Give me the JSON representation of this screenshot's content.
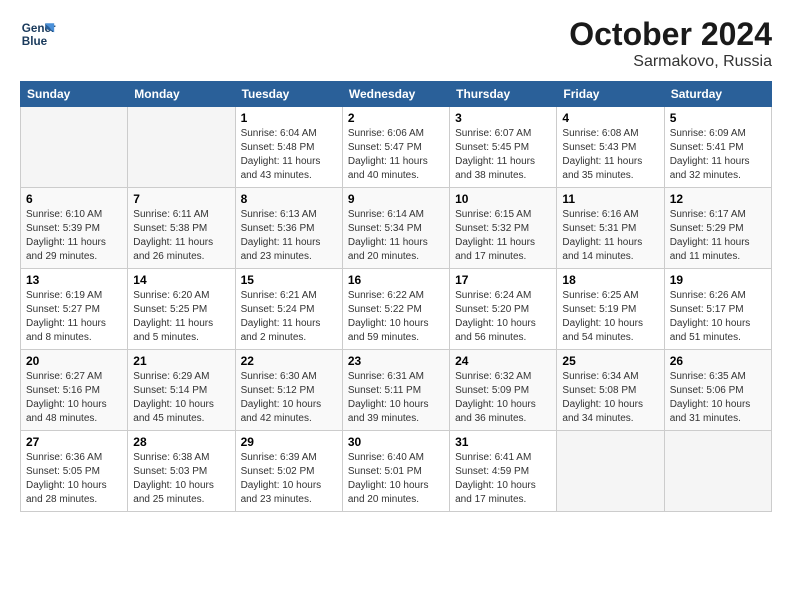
{
  "header": {
    "logo_line1": "General",
    "logo_line2": "Blue",
    "month_title": "October 2024",
    "location": "Sarmakovo, Russia"
  },
  "weekdays": [
    "Sunday",
    "Monday",
    "Tuesday",
    "Wednesday",
    "Thursday",
    "Friday",
    "Saturday"
  ],
  "weeks": [
    [
      {
        "day": "",
        "info": ""
      },
      {
        "day": "",
        "info": ""
      },
      {
        "day": "1",
        "info": "Sunrise: 6:04 AM\nSunset: 5:48 PM\nDaylight: 11 hours\nand 43 minutes."
      },
      {
        "day": "2",
        "info": "Sunrise: 6:06 AM\nSunset: 5:47 PM\nDaylight: 11 hours\nand 40 minutes."
      },
      {
        "day": "3",
        "info": "Sunrise: 6:07 AM\nSunset: 5:45 PM\nDaylight: 11 hours\nand 38 minutes."
      },
      {
        "day": "4",
        "info": "Sunrise: 6:08 AM\nSunset: 5:43 PM\nDaylight: 11 hours\nand 35 minutes."
      },
      {
        "day": "5",
        "info": "Sunrise: 6:09 AM\nSunset: 5:41 PM\nDaylight: 11 hours\nand 32 minutes."
      }
    ],
    [
      {
        "day": "6",
        "info": "Sunrise: 6:10 AM\nSunset: 5:39 PM\nDaylight: 11 hours\nand 29 minutes."
      },
      {
        "day": "7",
        "info": "Sunrise: 6:11 AM\nSunset: 5:38 PM\nDaylight: 11 hours\nand 26 minutes."
      },
      {
        "day": "8",
        "info": "Sunrise: 6:13 AM\nSunset: 5:36 PM\nDaylight: 11 hours\nand 23 minutes."
      },
      {
        "day": "9",
        "info": "Sunrise: 6:14 AM\nSunset: 5:34 PM\nDaylight: 11 hours\nand 20 minutes."
      },
      {
        "day": "10",
        "info": "Sunrise: 6:15 AM\nSunset: 5:32 PM\nDaylight: 11 hours\nand 17 minutes."
      },
      {
        "day": "11",
        "info": "Sunrise: 6:16 AM\nSunset: 5:31 PM\nDaylight: 11 hours\nand 14 minutes."
      },
      {
        "day": "12",
        "info": "Sunrise: 6:17 AM\nSunset: 5:29 PM\nDaylight: 11 hours\nand 11 minutes."
      }
    ],
    [
      {
        "day": "13",
        "info": "Sunrise: 6:19 AM\nSunset: 5:27 PM\nDaylight: 11 hours\nand 8 minutes."
      },
      {
        "day": "14",
        "info": "Sunrise: 6:20 AM\nSunset: 5:25 PM\nDaylight: 11 hours\nand 5 minutes."
      },
      {
        "day": "15",
        "info": "Sunrise: 6:21 AM\nSunset: 5:24 PM\nDaylight: 11 hours\nand 2 minutes."
      },
      {
        "day": "16",
        "info": "Sunrise: 6:22 AM\nSunset: 5:22 PM\nDaylight: 10 hours\nand 59 minutes."
      },
      {
        "day": "17",
        "info": "Sunrise: 6:24 AM\nSunset: 5:20 PM\nDaylight: 10 hours\nand 56 minutes."
      },
      {
        "day": "18",
        "info": "Sunrise: 6:25 AM\nSunset: 5:19 PM\nDaylight: 10 hours\nand 54 minutes."
      },
      {
        "day": "19",
        "info": "Sunrise: 6:26 AM\nSunset: 5:17 PM\nDaylight: 10 hours\nand 51 minutes."
      }
    ],
    [
      {
        "day": "20",
        "info": "Sunrise: 6:27 AM\nSunset: 5:16 PM\nDaylight: 10 hours\nand 48 minutes."
      },
      {
        "day": "21",
        "info": "Sunrise: 6:29 AM\nSunset: 5:14 PM\nDaylight: 10 hours\nand 45 minutes."
      },
      {
        "day": "22",
        "info": "Sunrise: 6:30 AM\nSunset: 5:12 PM\nDaylight: 10 hours\nand 42 minutes."
      },
      {
        "day": "23",
        "info": "Sunrise: 6:31 AM\nSunset: 5:11 PM\nDaylight: 10 hours\nand 39 minutes."
      },
      {
        "day": "24",
        "info": "Sunrise: 6:32 AM\nSunset: 5:09 PM\nDaylight: 10 hours\nand 36 minutes."
      },
      {
        "day": "25",
        "info": "Sunrise: 6:34 AM\nSunset: 5:08 PM\nDaylight: 10 hours\nand 34 minutes."
      },
      {
        "day": "26",
        "info": "Sunrise: 6:35 AM\nSunset: 5:06 PM\nDaylight: 10 hours\nand 31 minutes."
      }
    ],
    [
      {
        "day": "27",
        "info": "Sunrise: 6:36 AM\nSunset: 5:05 PM\nDaylight: 10 hours\nand 28 minutes."
      },
      {
        "day": "28",
        "info": "Sunrise: 6:38 AM\nSunset: 5:03 PM\nDaylight: 10 hours\nand 25 minutes."
      },
      {
        "day": "29",
        "info": "Sunrise: 6:39 AM\nSunset: 5:02 PM\nDaylight: 10 hours\nand 23 minutes."
      },
      {
        "day": "30",
        "info": "Sunrise: 6:40 AM\nSunset: 5:01 PM\nDaylight: 10 hours\nand 20 minutes."
      },
      {
        "day": "31",
        "info": "Sunrise: 6:41 AM\nSunset: 4:59 PM\nDaylight: 10 hours\nand 17 minutes."
      },
      {
        "day": "",
        "info": ""
      },
      {
        "day": "",
        "info": ""
      }
    ]
  ]
}
